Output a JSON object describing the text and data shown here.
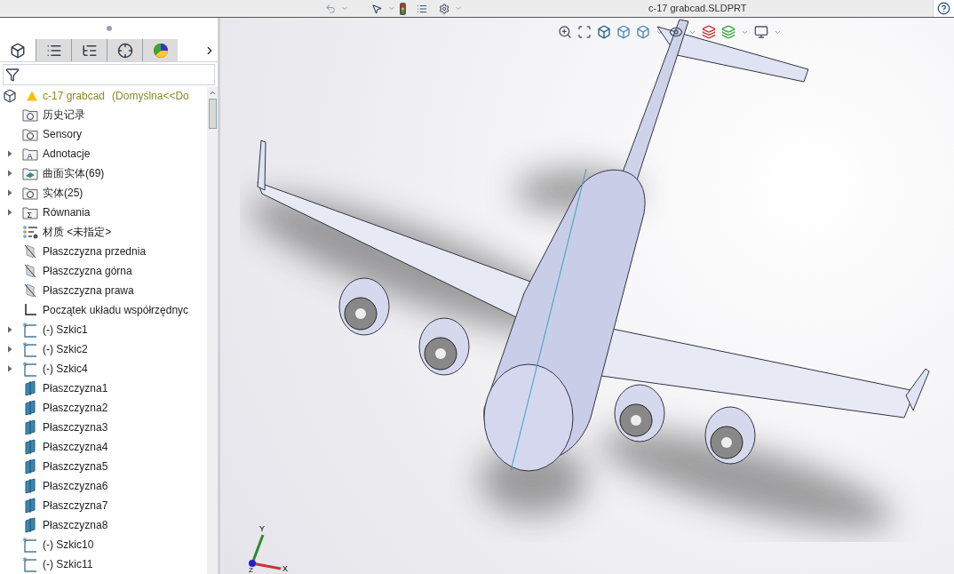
{
  "title": "c-17 grabcad.SLDPRT",
  "panel_tabs": [
    {
      "kind": "feature-tree",
      "selected": true
    },
    {
      "kind": "property",
      "selected": false
    },
    {
      "kind": "config",
      "selected": false
    },
    {
      "kind": "target",
      "selected": false
    },
    {
      "kind": "display",
      "selected": false
    }
  ],
  "tree": {
    "root": {
      "name": "c-17 grabcad",
      "config": "(Domyślna<<Do",
      "warning": true
    },
    "items": [
      {
        "label": "历史记录",
        "kind": "history",
        "expandable": false
      },
      {
        "label": "Sensory",
        "kind": "sensors",
        "expandable": false
      },
      {
        "label": "Adnotacje",
        "kind": "annotations",
        "expandable": true,
        "glyph": "A"
      },
      {
        "label": "曲面实体(69)",
        "kind": "surfaces",
        "expandable": true
      },
      {
        "label": "实体(25)",
        "kind": "solids",
        "expandable": true
      },
      {
        "label": "Równania",
        "kind": "equations",
        "expandable": true,
        "glyph": "Σ"
      },
      {
        "label": "材质 <未指定>",
        "kind": "material",
        "expandable": false
      },
      {
        "label": "Płaszczyzna przednia",
        "kind": "std-plane",
        "expandable": false
      },
      {
        "label": "Płaszczyzna górna",
        "kind": "std-plane",
        "expandable": false
      },
      {
        "label": "Płaszczyzna prawa",
        "kind": "std-plane",
        "expandable": false
      },
      {
        "label": "Początek układu współrzędnyc",
        "kind": "origin",
        "expandable": false
      },
      {
        "label": "(-) Szkic1",
        "kind": "sketch",
        "expandable": true
      },
      {
        "label": "(-) Szkic2",
        "kind": "sketch",
        "expandable": true
      },
      {
        "label": "(-) Szkic4",
        "kind": "sketch",
        "expandable": true
      },
      {
        "label": "Płaszczyzna1",
        "kind": "plane",
        "expandable": false
      },
      {
        "label": "Płaszczyzna2",
        "kind": "plane",
        "expandable": false
      },
      {
        "label": "Płaszczyzna3",
        "kind": "plane",
        "expandable": false
      },
      {
        "label": "Płaszczyzna4",
        "kind": "plane",
        "expandable": false
      },
      {
        "label": "Płaszczyzna5",
        "kind": "plane",
        "expandable": false
      },
      {
        "label": "Płaszczyzna6",
        "kind": "plane",
        "expandable": false
      },
      {
        "label": "Płaszczyzna7",
        "kind": "plane",
        "expandable": false
      },
      {
        "label": "Płaszczyzna8",
        "kind": "plane",
        "expandable": false
      },
      {
        "label": "(-) Szkic10",
        "kind": "sketch",
        "expandable": false
      },
      {
        "label": "(-) Szkic11",
        "kind": "sketch",
        "expandable": false
      }
    ]
  },
  "triad": {
    "x": "X",
    "y": "Y",
    "z": "Z"
  }
}
